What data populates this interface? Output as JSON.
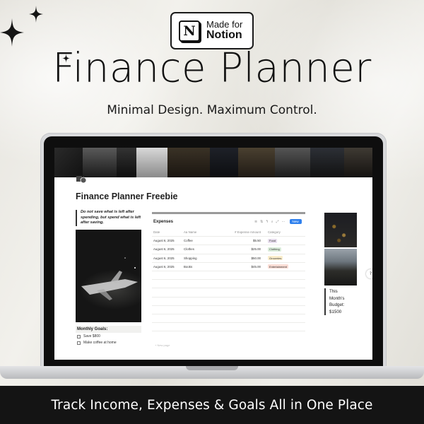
{
  "badge": {
    "line1": "Made for",
    "line2": "Notion",
    "logo_letter": "N"
  },
  "title": "Finance Planner",
  "subtitle": "Minimal Design. Maximum Control.",
  "screen": {
    "page_title": "Finance Planner Freebie",
    "quote": "Do not save what is left after spending, but spend what is left after saving.",
    "goals_title": "Monthly Goals:",
    "goals": [
      {
        "label": "Save $800"
      },
      {
        "label": "Make coffee at home"
      }
    ],
    "database": {
      "title": "Expenses",
      "new_label": "New",
      "columns": [
        "Date",
        "Aa Name",
        "# Expense Amount",
        "Category"
      ],
      "rows": [
        {
          "date": "August 6, 2025",
          "name": "Coffee",
          "amount": "$5.50",
          "category": "Food"
        },
        {
          "date": "August 6, 2025",
          "name": "Clothes",
          "amount": "$25.00",
          "category": "Clothing"
        },
        {
          "date": "August 6, 2025",
          "name": "Shopping",
          "amount": "$50.00",
          "category": "Groceries"
        },
        {
          "date": "August 6, 2025",
          "name": "Books",
          "amount": "$45.00",
          "category": "Entertainment"
        }
      ],
      "new_page_label": "+ New page"
    },
    "budget_lines": [
      "This",
      "Month's",
      "Budget:",
      "$1500"
    ],
    "help_label": "?"
  },
  "tag_colors": {
    "Food": "#e8deee",
    "Clothing": "#dbeddb",
    "Groceries": "#fbeecc",
    "Entertainment": "#fadcd4"
  },
  "footer": "Track Income, Expenses & Goals All in One Place"
}
